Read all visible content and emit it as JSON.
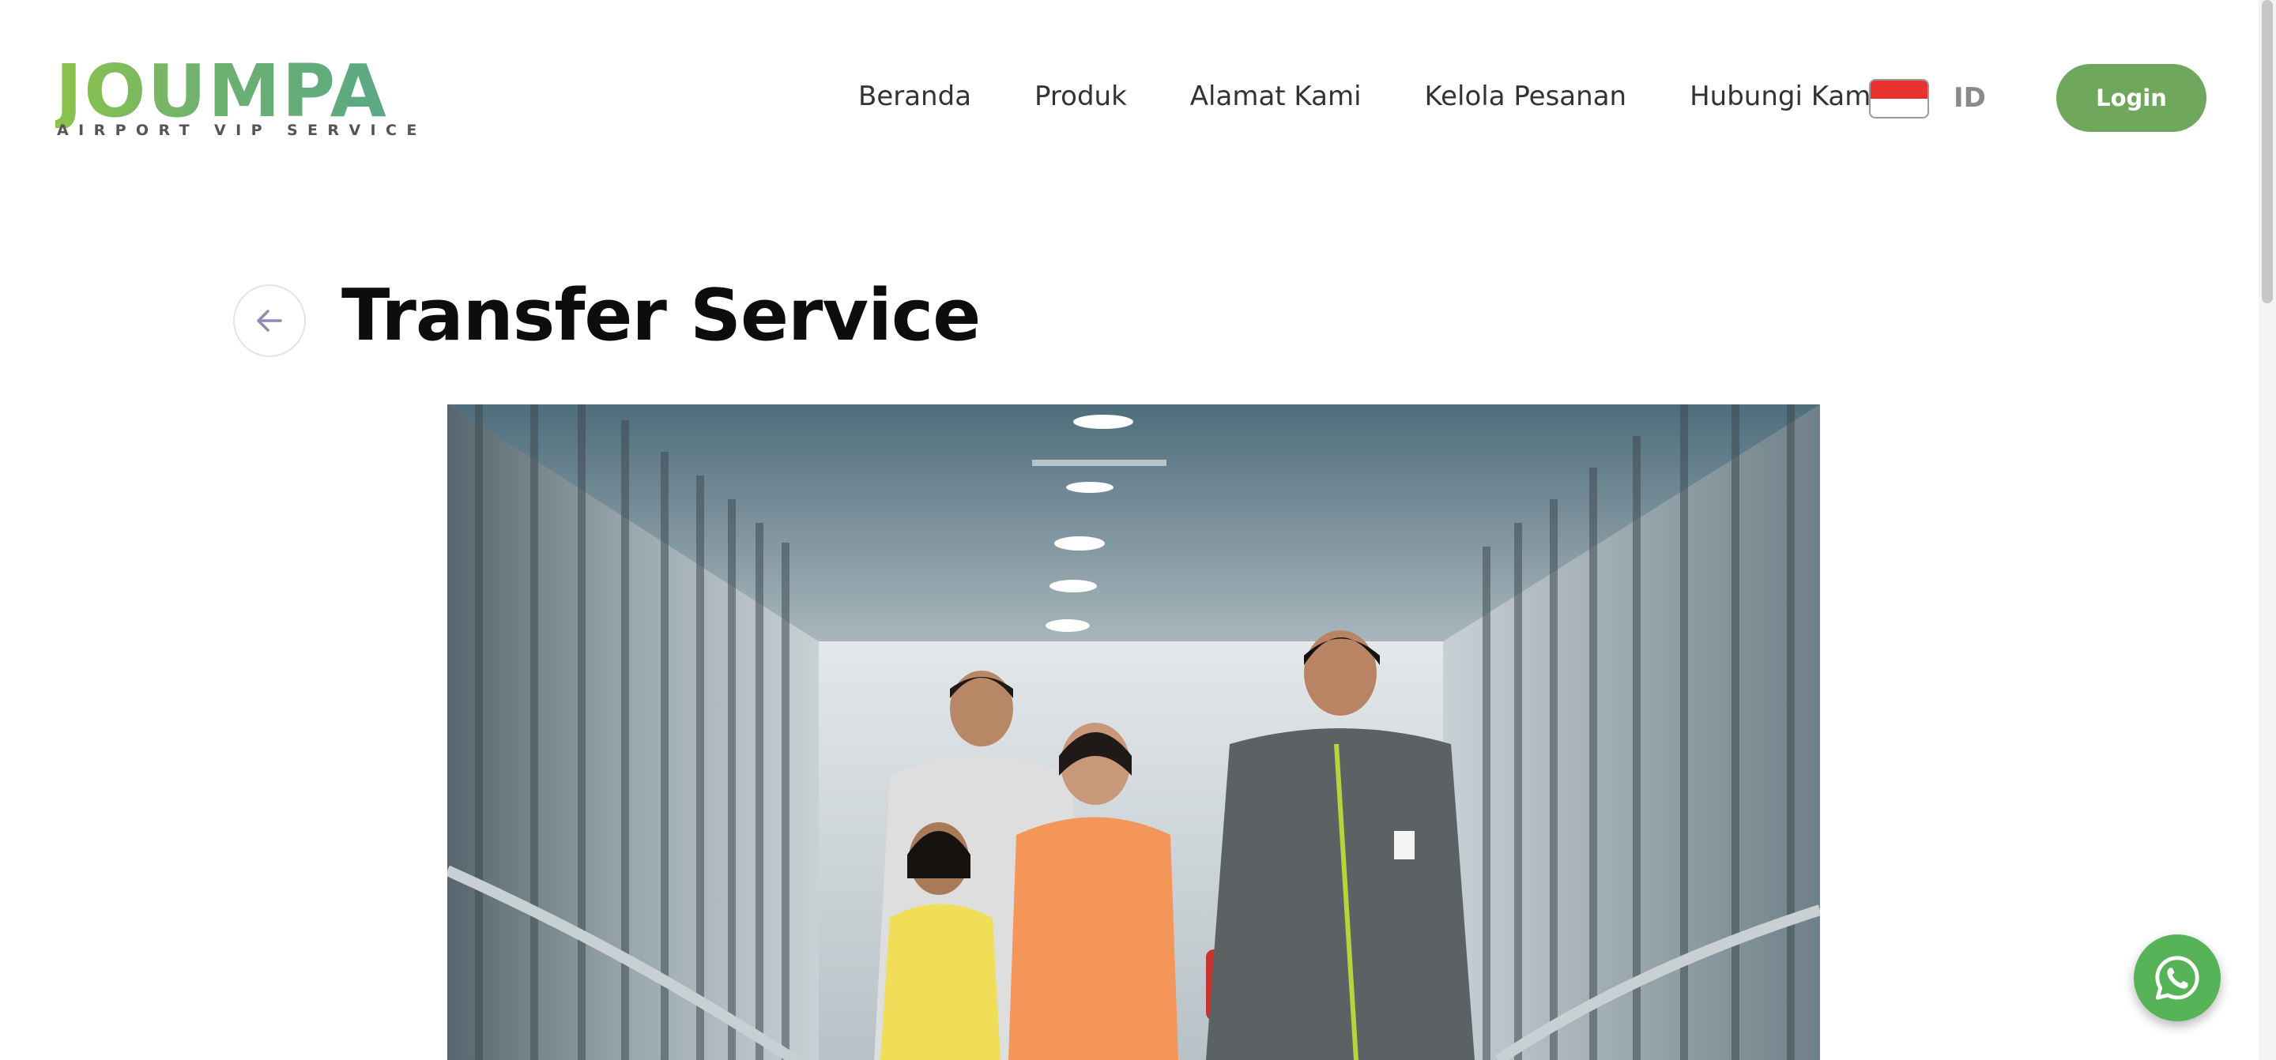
{
  "header": {
    "logo": {
      "word": "JOUMPA",
      "tagline": "AIRPORT VIP SERVICE"
    },
    "nav": [
      {
        "label": "Beranda"
      },
      {
        "label": "Produk"
      },
      {
        "label": "Alamat Kami"
      },
      {
        "label": "Kelola Pesanan"
      },
      {
        "label": "Hubungi Kami"
      }
    ],
    "language": {
      "code": "ID",
      "flag": "indonesia-flag-icon"
    },
    "login_label": "Login"
  },
  "main": {
    "back_icon": "arrow-left-icon",
    "title": "Transfer Service",
    "hero_image": "airport-jet-bridge-family-with-staff-photo"
  },
  "floating": {
    "whatsapp_icon": "whatsapp-icon"
  },
  "colors": {
    "accent_green": "#6fa85c",
    "whatsapp_green": "#57b357",
    "flag_red": "#e8322f",
    "title_text": "#0d0d0d"
  }
}
